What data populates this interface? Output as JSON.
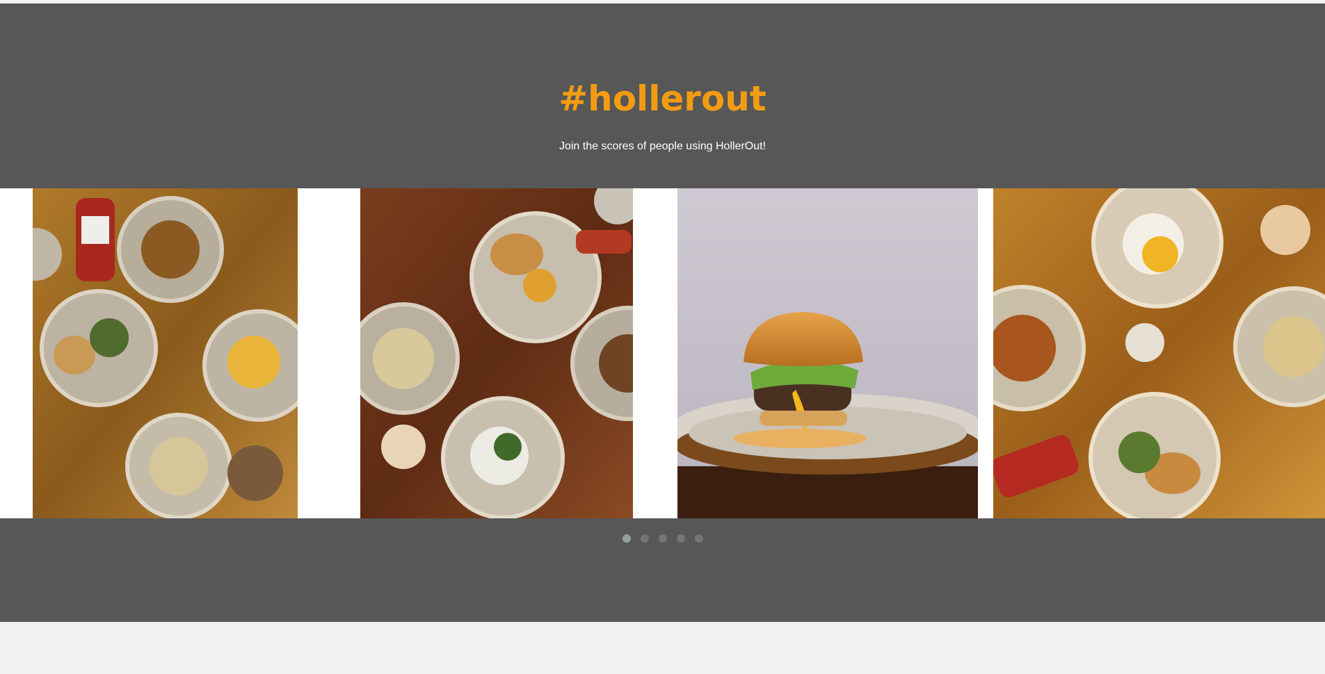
{
  "hero": {
    "title": "#hollerout",
    "subtitle": "Join the scores of people using HollerOut!"
  },
  "carousel": {
    "slides": [
      {
        "icon": "food-table-photo-icon"
      },
      {
        "icon": "food-table-photo-icon"
      },
      {
        "icon": "burger-photo-icon"
      },
      {
        "icon": "food-table-photo-icon"
      }
    ],
    "dot_count": 5,
    "active_index": 0
  },
  "colors": {
    "hero_bg": "#575757",
    "accent": "#f39c12",
    "page_bg": "#f2f2f2",
    "dot": "#757575",
    "dot_active": "#8fa3a3"
  }
}
